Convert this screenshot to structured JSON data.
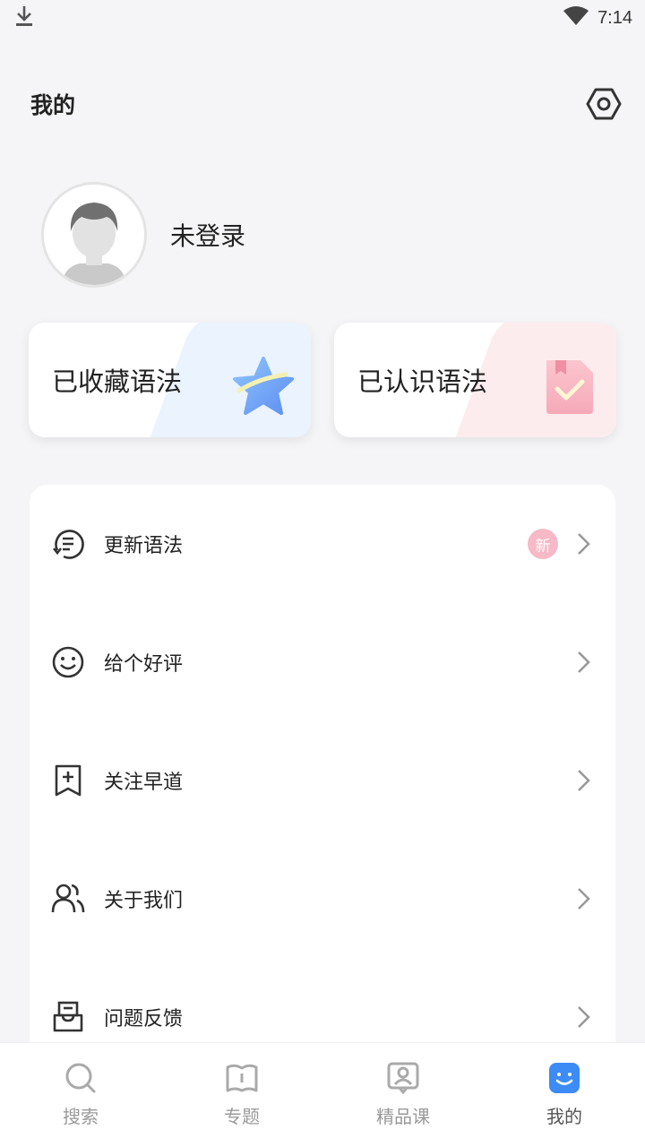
{
  "status_bar": {
    "time": "7:14",
    "icons": [
      "download-icon",
      "wifi-icon"
    ]
  },
  "header": {
    "title": "我的",
    "settings_icon": "gear-hexagon-icon"
  },
  "profile": {
    "login_status": "未登录",
    "avatar_icon": "default-avatar-icon"
  },
  "cards": [
    {
      "label": "已收藏语法",
      "icon": "star-icon",
      "accent": "#eaf3fe"
    },
    {
      "label": "已认识语法",
      "icon": "checked-bookmark-icon",
      "accent": "#fdecee"
    }
  ],
  "menu": {
    "items": [
      {
        "label": "更新语法",
        "icon": "refresh-list-icon",
        "badge": "新"
      },
      {
        "label": "给个好评",
        "icon": "smiley-icon"
      },
      {
        "label": "关注早道",
        "icon": "bookmark-plus-icon"
      },
      {
        "label": "关于我们",
        "icon": "users-icon"
      },
      {
        "label": "问题反馈",
        "icon": "feedback-inbox-icon"
      }
    ]
  },
  "tabbar": {
    "tabs": [
      {
        "label": "搜索",
        "icon": "search-icon",
        "active": false
      },
      {
        "label": "专题",
        "icon": "book-icon",
        "active": false
      },
      {
        "label": "精品课",
        "icon": "course-icon",
        "active": false
      },
      {
        "label": "我的",
        "icon": "smile-face-icon",
        "active": true
      }
    ],
    "active_color": "#3d8bf5"
  }
}
